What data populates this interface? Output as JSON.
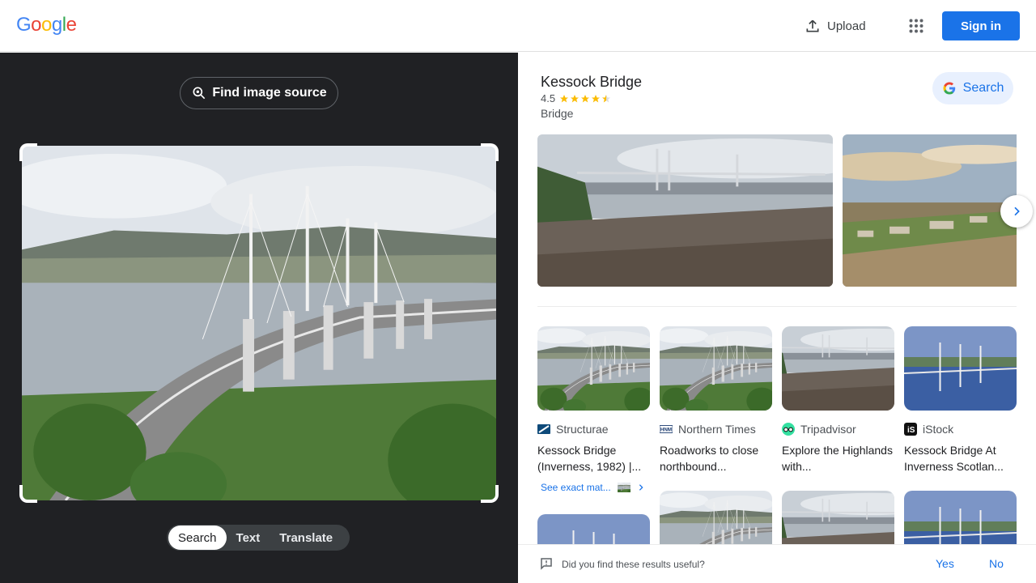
{
  "header": {
    "logo": [
      "G",
      "o",
      "o",
      "g",
      "l",
      "e"
    ],
    "upload_label": "Upload",
    "signin_label": "Sign in"
  },
  "left": {
    "find_source_label": "Find image source",
    "tabs": [
      "Search",
      "Text",
      "Translate"
    ],
    "active_tab": "Search"
  },
  "knowledge_panel": {
    "title": "Kessock Bridge",
    "rating": "4.5",
    "rating_stars": 4.5,
    "type": "Bridge",
    "search_label": "Search"
  },
  "results": [
    {
      "source": "Structurae",
      "title": "Kessock Bridge (Inverness, 1982) |...",
      "favicon": "structurae-icon"
    },
    {
      "source": "Northern Times",
      "title": "Roadworks to close northbound...",
      "favicon": "northern-times-icon"
    },
    {
      "source": "Tripadvisor",
      "title": "Explore the Highlands with...",
      "favicon": "tripadvisor-icon"
    },
    {
      "source": "iStock",
      "title": "Kessock Bridge At Inverness Scotlan...",
      "favicon": "istock-icon"
    }
  ],
  "see_exact_label": "See exact mat...",
  "feedback": {
    "question": "Did you find these results useful?",
    "yes": "Yes",
    "no": "No"
  },
  "colors": {
    "brand_blue": "#1a73e8",
    "dark_pane": "#202124",
    "star": "#fbbc04"
  }
}
